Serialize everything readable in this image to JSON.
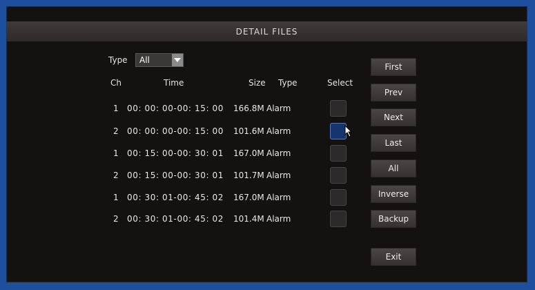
{
  "window": {
    "title": "DETAIL FILES"
  },
  "filter": {
    "type_label": "Type",
    "type_value": "All"
  },
  "columns": {
    "ch": "Ch",
    "time": "Time",
    "size": "Size",
    "type": "Type",
    "select": "Select"
  },
  "files": [
    {
      "ch": "1",
      "time": "00: 00: 00-00: 15: 00",
      "size": "166.8M",
      "type": "Alarm",
      "selected": false
    },
    {
      "ch": "2",
      "time": "00: 00: 00-00: 15: 00",
      "size": "101.6M",
      "type": "Alarm",
      "selected": true
    },
    {
      "ch": "1",
      "time": "00: 15: 00-00: 30: 01",
      "size": "167.0M",
      "type": "Alarm",
      "selected": false
    },
    {
      "ch": "2",
      "time": "00: 15: 00-00: 30: 01",
      "size": "101.7M",
      "type": "Alarm",
      "selected": false
    },
    {
      "ch": "1",
      "time": "00: 30: 01-00: 45: 02",
      "size": "167.0M",
      "type": "Alarm",
      "selected": false
    },
    {
      "ch": "2",
      "time": "00: 30: 01-00: 45: 02",
      "size": "101.4M",
      "type": "Alarm",
      "selected": false
    }
  ],
  "buttons": {
    "first": "First",
    "prev": "Prev",
    "next": "Next",
    "last": "Last",
    "all": "All",
    "inverse": "Inverse",
    "backup": "Backup",
    "exit": "Exit"
  },
  "colors": {
    "accent": "#1d4f9c",
    "selected_box": "#16356e",
    "panel": "#141111"
  }
}
